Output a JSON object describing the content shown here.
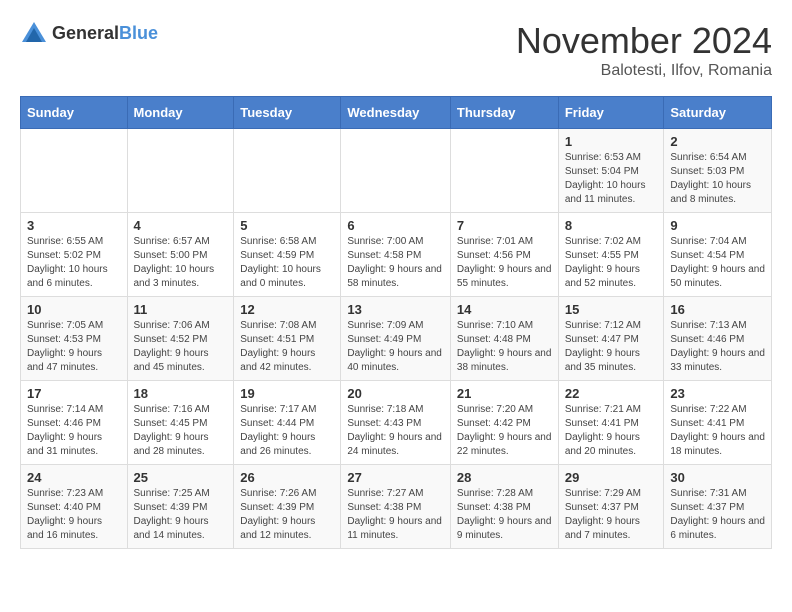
{
  "logo": {
    "text_general": "General",
    "text_blue": "Blue"
  },
  "header": {
    "month_year": "November 2024",
    "location": "Balotesti, Ilfov, Romania"
  },
  "weekdays": [
    "Sunday",
    "Monday",
    "Tuesday",
    "Wednesday",
    "Thursday",
    "Friday",
    "Saturday"
  ],
  "weeks": [
    [
      {
        "day": "",
        "sunrise": "",
        "sunset": "",
        "daylight": ""
      },
      {
        "day": "",
        "sunrise": "",
        "sunset": "",
        "daylight": ""
      },
      {
        "day": "",
        "sunrise": "",
        "sunset": "",
        "daylight": ""
      },
      {
        "day": "",
        "sunrise": "",
        "sunset": "",
        "daylight": ""
      },
      {
        "day": "",
        "sunrise": "",
        "sunset": "",
        "daylight": ""
      },
      {
        "day": "1",
        "sunrise": "Sunrise: 6:53 AM",
        "sunset": "Sunset: 5:04 PM",
        "daylight": "Daylight: 10 hours and 11 minutes."
      },
      {
        "day": "2",
        "sunrise": "Sunrise: 6:54 AM",
        "sunset": "Sunset: 5:03 PM",
        "daylight": "Daylight: 10 hours and 8 minutes."
      }
    ],
    [
      {
        "day": "3",
        "sunrise": "Sunrise: 6:55 AM",
        "sunset": "Sunset: 5:02 PM",
        "daylight": "Daylight: 10 hours and 6 minutes."
      },
      {
        "day": "4",
        "sunrise": "Sunrise: 6:57 AM",
        "sunset": "Sunset: 5:00 PM",
        "daylight": "Daylight: 10 hours and 3 minutes."
      },
      {
        "day": "5",
        "sunrise": "Sunrise: 6:58 AM",
        "sunset": "Sunset: 4:59 PM",
        "daylight": "Daylight: 10 hours and 0 minutes."
      },
      {
        "day": "6",
        "sunrise": "Sunrise: 7:00 AM",
        "sunset": "Sunset: 4:58 PM",
        "daylight": "Daylight: 9 hours and 58 minutes."
      },
      {
        "day": "7",
        "sunrise": "Sunrise: 7:01 AM",
        "sunset": "Sunset: 4:56 PM",
        "daylight": "Daylight: 9 hours and 55 minutes."
      },
      {
        "day": "8",
        "sunrise": "Sunrise: 7:02 AM",
        "sunset": "Sunset: 4:55 PM",
        "daylight": "Daylight: 9 hours and 52 minutes."
      },
      {
        "day": "9",
        "sunrise": "Sunrise: 7:04 AM",
        "sunset": "Sunset: 4:54 PM",
        "daylight": "Daylight: 9 hours and 50 minutes."
      }
    ],
    [
      {
        "day": "10",
        "sunrise": "Sunrise: 7:05 AM",
        "sunset": "Sunset: 4:53 PM",
        "daylight": "Daylight: 9 hours and 47 minutes."
      },
      {
        "day": "11",
        "sunrise": "Sunrise: 7:06 AM",
        "sunset": "Sunset: 4:52 PM",
        "daylight": "Daylight: 9 hours and 45 minutes."
      },
      {
        "day": "12",
        "sunrise": "Sunrise: 7:08 AM",
        "sunset": "Sunset: 4:51 PM",
        "daylight": "Daylight: 9 hours and 42 minutes."
      },
      {
        "day": "13",
        "sunrise": "Sunrise: 7:09 AM",
        "sunset": "Sunset: 4:49 PM",
        "daylight": "Daylight: 9 hours and 40 minutes."
      },
      {
        "day": "14",
        "sunrise": "Sunrise: 7:10 AM",
        "sunset": "Sunset: 4:48 PM",
        "daylight": "Daylight: 9 hours and 38 minutes."
      },
      {
        "day": "15",
        "sunrise": "Sunrise: 7:12 AM",
        "sunset": "Sunset: 4:47 PM",
        "daylight": "Daylight: 9 hours and 35 minutes."
      },
      {
        "day": "16",
        "sunrise": "Sunrise: 7:13 AM",
        "sunset": "Sunset: 4:46 PM",
        "daylight": "Daylight: 9 hours and 33 minutes."
      }
    ],
    [
      {
        "day": "17",
        "sunrise": "Sunrise: 7:14 AM",
        "sunset": "Sunset: 4:46 PM",
        "daylight": "Daylight: 9 hours and 31 minutes."
      },
      {
        "day": "18",
        "sunrise": "Sunrise: 7:16 AM",
        "sunset": "Sunset: 4:45 PM",
        "daylight": "Daylight: 9 hours and 28 minutes."
      },
      {
        "day": "19",
        "sunrise": "Sunrise: 7:17 AM",
        "sunset": "Sunset: 4:44 PM",
        "daylight": "Daylight: 9 hours and 26 minutes."
      },
      {
        "day": "20",
        "sunrise": "Sunrise: 7:18 AM",
        "sunset": "Sunset: 4:43 PM",
        "daylight": "Daylight: 9 hours and 24 minutes."
      },
      {
        "day": "21",
        "sunrise": "Sunrise: 7:20 AM",
        "sunset": "Sunset: 4:42 PM",
        "daylight": "Daylight: 9 hours and 22 minutes."
      },
      {
        "day": "22",
        "sunrise": "Sunrise: 7:21 AM",
        "sunset": "Sunset: 4:41 PM",
        "daylight": "Daylight: 9 hours and 20 minutes."
      },
      {
        "day": "23",
        "sunrise": "Sunrise: 7:22 AM",
        "sunset": "Sunset: 4:41 PM",
        "daylight": "Daylight: 9 hours and 18 minutes."
      }
    ],
    [
      {
        "day": "24",
        "sunrise": "Sunrise: 7:23 AM",
        "sunset": "Sunset: 4:40 PM",
        "daylight": "Daylight: 9 hours and 16 minutes."
      },
      {
        "day": "25",
        "sunrise": "Sunrise: 7:25 AM",
        "sunset": "Sunset: 4:39 PM",
        "daylight": "Daylight: 9 hours and 14 minutes."
      },
      {
        "day": "26",
        "sunrise": "Sunrise: 7:26 AM",
        "sunset": "Sunset: 4:39 PM",
        "daylight": "Daylight: 9 hours and 12 minutes."
      },
      {
        "day": "27",
        "sunrise": "Sunrise: 7:27 AM",
        "sunset": "Sunset: 4:38 PM",
        "daylight": "Daylight: 9 hours and 11 minutes."
      },
      {
        "day": "28",
        "sunrise": "Sunrise: 7:28 AM",
        "sunset": "Sunset: 4:38 PM",
        "daylight": "Daylight: 9 hours and 9 minutes."
      },
      {
        "day": "29",
        "sunrise": "Sunrise: 7:29 AM",
        "sunset": "Sunset: 4:37 PM",
        "daylight": "Daylight: 9 hours and 7 minutes."
      },
      {
        "day": "30",
        "sunrise": "Sunrise: 7:31 AM",
        "sunset": "Sunset: 4:37 PM",
        "daylight": "Daylight: 9 hours and 6 minutes."
      }
    ]
  ]
}
